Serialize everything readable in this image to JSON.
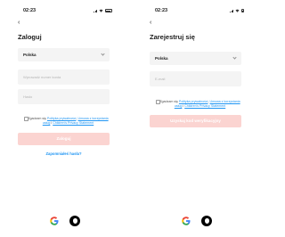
{
  "status": {
    "time": "02:23"
  },
  "icons": {
    "back": "chevron-left-icon",
    "google": "google-icon",
    "apple": "apple-icon"
  },
  "colors": {
    "link": "#2196f3",
    "primary_disabled": "#fbd4d1"
  },
  "login": {
    "title": "Zaloguj",
    "country": "Polska",
    "phone_placeholder": "Wprowadź numer konta",
    "password_placeholder": "Hasło",
    "consent_prefix": "Zgadzam się",
    "privacy_link": "Polityka prywatności",
    "agreement_link": "Umowa z korzystania usług",
    "separator": "i",
    "children_link": "Children's Privacy Statement",
    "submit": "Zaloguj",
    "forgot": "Zapomniałeś hasła?"
  },
  "register": {
    "title": "Zarejestruj się",
    "country": "Polska",
    "email_placeholder": "E-mail",
    "consent_prefix": "Zgadzam się",
    "privacy_link": "Polityka prywatności",
    "agreement_link": "Umowa z korzystania usług",
    "separator": "i",
    "children_link": "Children's Privacy Statement",
    "submit": "Uzyskaj kod weryfikacyjny"
  }
}
